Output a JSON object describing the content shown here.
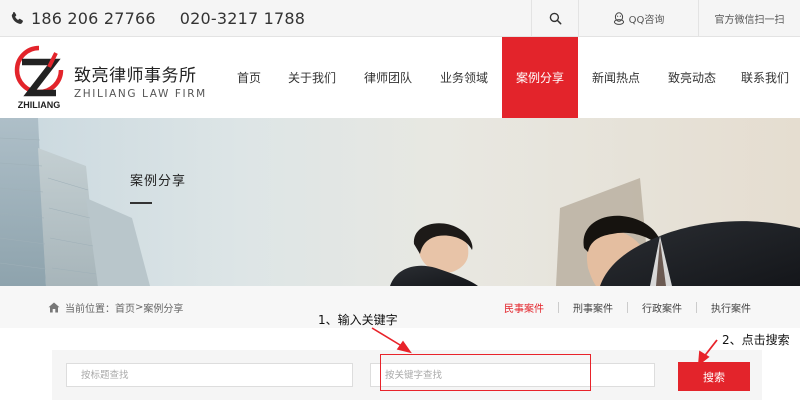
{
  "topbar": {
    "phone_icon": "phone-icon",
    "phone1": "186 206 27766",
    "phone2": "020-3217 1788",
    "search_icon": "search-icon",
    "qq_label": "QQ咨询",
    "wechat_label": "官方微信扫一扫"
  },
  "logo": {
    "mark_text": "ZHILIANG",
    "name_cn": "致亮律师事务所",
    "name_en": "ZHILIANG LAW FIRM",
    "brand_color": "#e3242b"
  },
  "nav": {
    "items": [
      {
        "label": "首页"
      },
      {
        "label": "关于我们"
      },
      {
        "label": "律师团队"
      },
      {
        "label": "业务领域"
      },
      {
        "label": "案例分享",
        "active": true
      },
      {
        "label": "新闻热点"
      },
      {
        "label": "致亮动态"
      },
      {
        "label": "联系我们"
      }
    ]
  },
  "banner": {
    "title": "案例分享"
  },
  "breadcrumb": {
    "prefix": "当前位置：",
    "home": "首页",
    "separator": ">",
    "current": "案例分享"
  },
  "categories": [
    {
      "label": "民事案件",
      "active": true
    },
    {
      "label": "刑事案件"
    },
    {
      "label": "行政案件"
    },
    {
      "label": "执行案件"
    }
  ],
  "search": {
    "title_placeholder": "按标题查找",
    "keyword_placeholder": "按关键字查找",
    "button_label": "搜索"
  },
  "annotations": {
    "step1": "1、输入关键字",
    "step2": "2、点击搜索",
    "color": "#e8232a"
  }
}
